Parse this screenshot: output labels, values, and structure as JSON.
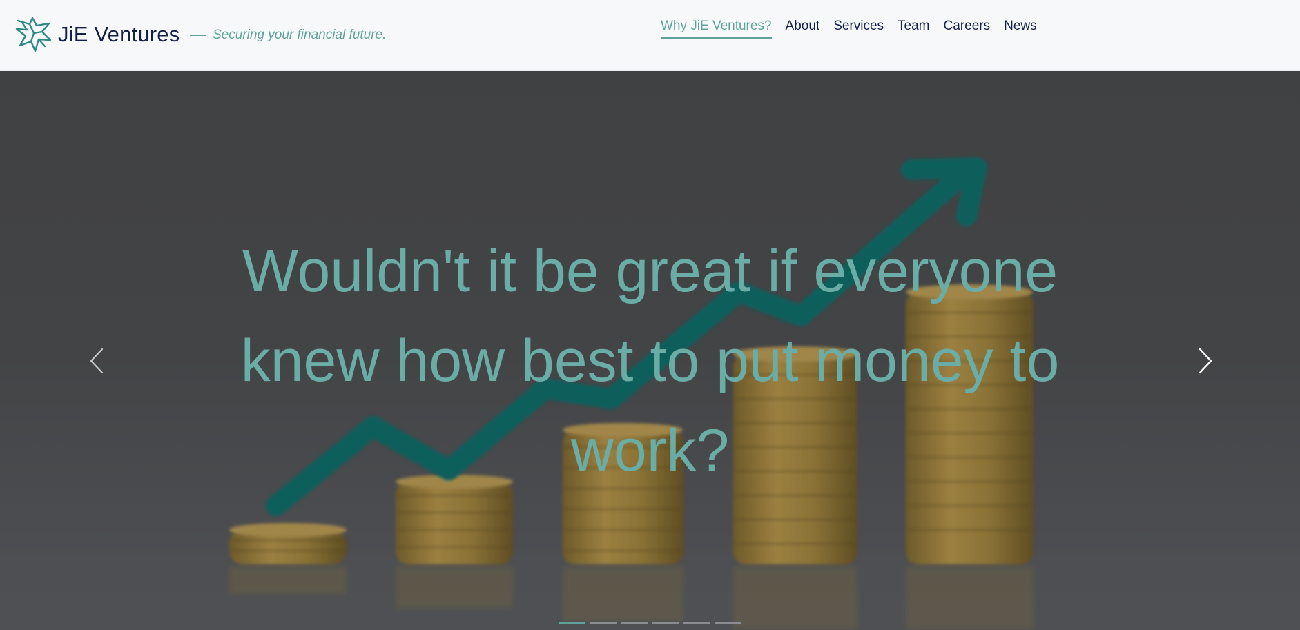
{
  "brand": {
    "name": "JiE Ventures",
    "tagline": "Securing your financial future."
  },
  "nav": {
    "items": [
      {
        "label": "Why JiE Ventures?",
        "active": true
      },
      {
        "label": "About",
        "active": false
      },
      {
        "label": "Services",
        "active": false
      },
      {
        "label": "Team",
        "active": false
      },
      {
        "label": "Careers",
        "active": false
      },
      {
        "label": "News",
        "active": false
      }
    ]
  },
  "hero": {
    "heading": "Wouldn't it be great if everyone knew how best to put money to work?",
    "background_image": "rising-arrow-over-coin-stacks",
    "prev_icon": "chevron-left-icon",
    "next_icon": "chevron-right-icon",
    "slides_total": 6,
    "active_slide": 1
  },
  "colors": {
    "accent": "#5fa29c",
    "brand_text": "#13204a",
    "header_bg": "#f7f8fa",
    "hero_overlay": "#424345"
  }
}
